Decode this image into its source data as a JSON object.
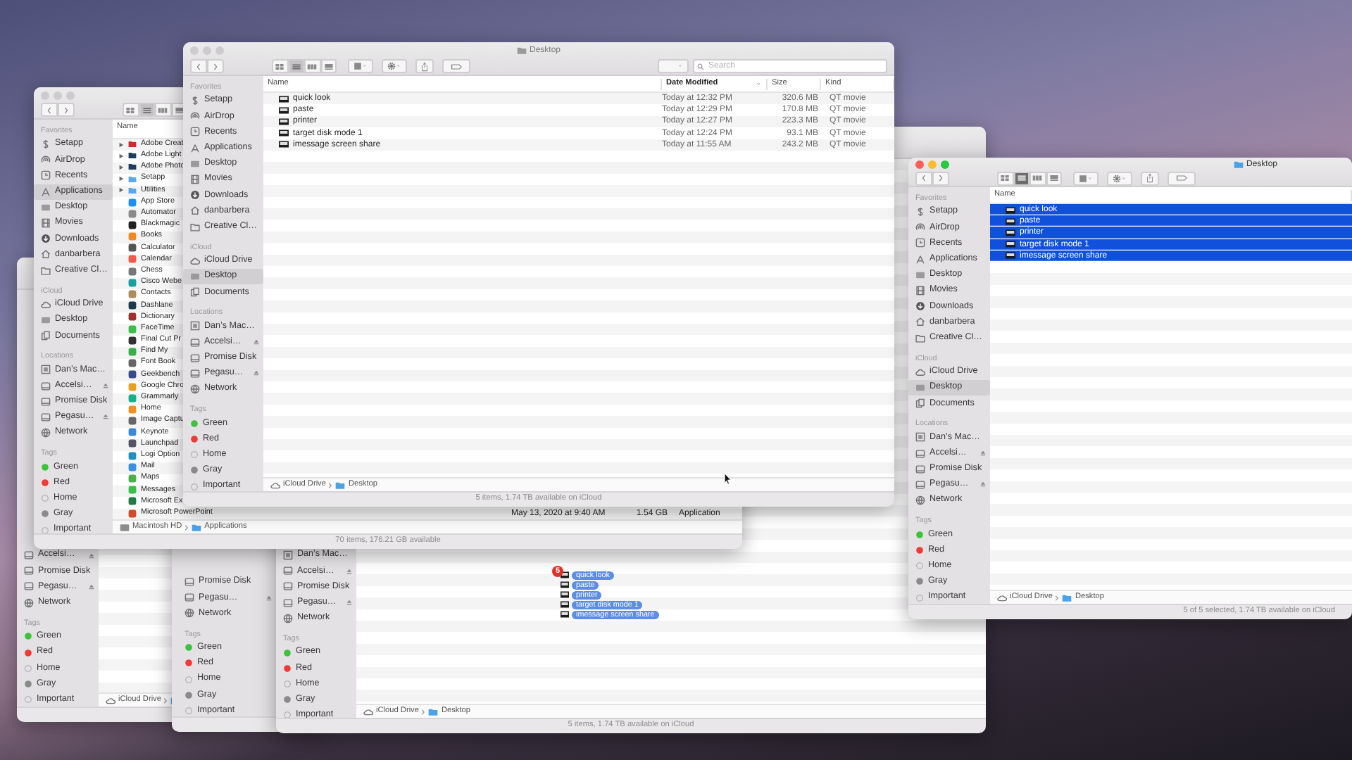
{
  "windows": [
    {
      "sidebar": [
        {
          "items": [
            {
              "label": "Accelsi…",
              "kind": "ext-disk",
              "selected": false
            },
            {
              "label": "Promise Disk",
              "kind": "disk",
              "selected": false
            },
            {
              "label": "Pegasu…",
              "kind": "ext-disk",
              "selected": false
            },
            {
              "label": "Network",
              "kind": "network",
              "selected": false
            }
          ]
        },
        {
          "heading": "Tags",
          "items": [
            {
              "label": "Green",
              "kind": "tag",
              "color": "#3cc23c",
              "selected": false
            },
            {
              "label": "Red",
              "kind": "tag",
              "color": "#f03a35",
              "selected": false
            },
            {
              "label": "Home",
              "kind": "tag",
              "selected": false
            },
            {
              "label": "Gray",
              "kind": "tag",
              "color": "#8a8a8a",
              "selected": false
            },
            {
              "label": "Important",
              "kind": "tag",
              "selected": false
            }
          ]
        }
      ],
      "path": [
        {
          "kind": "cloud",
          "label": "iCloud Drive"
        },
        {
          "kind": "folder"
        }
      ]
    },
    {
      "sidebar": [
        {
          "items": [
            {
              "label": "Promise Disk",
              "kind": "disk",
              "selected": false
            },
            {
              "label": "Pegasu…",
              "kind": "ext-disk",
              "selected": false
            },
            {
              "label": "Network",
              "kind": "network",
              "selected": false
            }
          ]
        },
        {
          "heading": "Tags",
          "items": [
            {
              "label": "Green",
              "kind": "tag",
              "color": "#3cc23c",
              "selected": false
            },
            {
              "label": "Red",
              "kind": "tag",
              "color": "#f03a35",
              "selected": false
            },
            {
              "label": "Home",
              "kind": "tag",
              "selected": false
            },
            {
              "label": "Gray",
              "kind": "tag",
              "color": "#8a8a8a",
              "selected": false
            },
            {
              "label": "Important",
              "kind": "tag",
              "selected": false
            }
          ]
        }
      ]
    },
    {
      "sidebar": [
        {
          "items": [
            {
              "label": "Dan’s Mac…",
              "kind": "computer",
              "selected": false
            },
            {
              "label": "Accelsi…",
              "kind": "ext-disk",
              "selected": false
            },
            {
              "label": "Promise Disk",
              "kind": "disk",
              "selected": false
            },
            {
              "label": "Pegasu…",
              "kind": "ext-disk",
              "selected": false
            },
            {
              "label": "Network",
              "kind": "network",
              "selected": false
            }
          ]
        },
        {
          "heading": "Tags",
          "items": [
            {
              "label": "Green",
              "kind": "tag",
              "color": "#3cc23c",
              "selected": false
            },
            {
              "label": "Red",
              "kind": "tag",
              "color": "#f03a35",
              "selected": false
            },
            {
              "label": "Home",
              "kind": "tag",
              "selected": false
            },
            {
              "label": "Gray",
              "kind": "tag",
              "color": "#8a8a8a",
              "selected": false
            },
            {
              "label": "Important",
              "kind": "tag",
              "selected": false
            }
          ]
        }
      ],
      "path": [
        {
          "kind": "cloud",
          "label": "iCloud Drive"
        },
        {
          "kind": "folder",
          "label": "Desktop"
        }
      ],
      "status": "5 items, 1.74 TB available on iCloud"
    },
    {
      "active": false,
      "toolbar": {
        "views": [
          {
            "selected": false
          },
          {
            "selected": true
          },
          {
            "selected": false
          },
          {
            "selected": false
          }
        ]
      },
      "sidebar": [
        {
          "heading": "Favorites",
          "items": [
            {
              "label": "Setapp",
              "kind": "app",
              "selected": false
            },
            {
              "label": "AirDrop",
              "kind": "airdrop",
              "selected": false
            },
            {
              "label": "Recents",
              "kind": "recents",
              "selected": false
            },
            {
              "label": "Applications",
              "kind": "applications",
              "selected": true
            },
            {
              "label": "Desktop",
              "kind": "desktop",
              "selected": false
            },
            {
              "label": "Movies",
              "kind": "film",
              "selected": false
            },
            {
              "label": "Downloads",
              "kind": "download",
              "selected": false
            },
            {
              "label": "danbarbera",
              "kind": "home",
              "selected": false
            },
            {
              "label": "Creative Cl…",
              "kind": "folder",
              "selected": false
            }
          ]
        },
        {
          "heading": "iCloud",
          "items": [
            {
              "label": "iCloud Drive",
              "kind": "cloud",
              "selected": false
            },
            {
              "label": "Desktop",
              "kind": "desktop",
              "selected": false
            },
            {
              "label": "Documents",
              "kind": "documents",
              "selected": false
            }
          ]
        },
        {
          "heading": "Locations",
          "items": [
            {
              "label": "Dan’s Mac…",
              "kind": "computer",
              "selected": false
            },
            {
              "label": "Accelsi…",
              "kind": "ext-disk",
              "selected": false
            },
            {
              "label": "Promise Disk",
              "kind": "disk",
              "selected": false
            },
            {
              "label": "Pegasu…",
              "kind": "ext-disk",
              "selected": false
            },
            {
              "label": "Network",
              "kind": "network",
              "selected": false
            }
          ]
        },
        {
          "heading": "Tags",
          "items": [
            {
              "label": "Green",
              "kind": "tag",
              "color": "#3cc23c",
              "selected": false
            },
            {
              "label": "Red",
              "kind": "tag",
              "color": "#f03a35",
              "selected": false
            },
            {
              "label": "Home",
              "kind": "tag",
              "selected": false
            },
            {
              "label": "Gray",
              "kind": "tag",
              "color": "#8a8a8a",
              "selected": false
            },
            {
              "label": "Important",
              "kind": "tag",
              "selected": false
            }
          ]
        }
      ],
      "columns": [
        {
          "label": "Name",
          "sorted": false
        }
      ],
      "rows": [
        {
          "name": "Adobe Creat",
          "kind": "folder",
          "color": "#d8262e",
          "selected": false
        },
        {
          "name": "Adobe Light",
          "kind": "folder",
          "color": "#1d3d5c",
          "selected": false
        },
        {
          "name": "Adobe Photo",
          "kind": "folder",
          "color": "#1f3b60",
          "selected": false
        },
        {
          "name": "Setapp",
          "kind": "folder",
          "color": "#5aa9e6",
          "selected": false
        },
        {
          "name": "Utilities",
          "kind": "folder",
          "color": "#5aa9e6",
          "selected": false
        },
        {
          "name": "App Store",
          "kind": "app",
          "color": "#1e8ef0",
          "selected": false
        },
        {
          "name": "Automator",
          "kind": "app",
          "color": "#8a8a8a",
          "selected": false
        },
        {
          "name": "Blackmagic",
          "kind": "app",
          "color": "#222222",
          "selected": false
        },
        {
          "name": "Books",
          "kind": "app",
          "color": "#f08a24",
          "selected": false
        },
        {
          "name": "Calculator",
          "kind": "app",
          "color": "#555555",
          "selected": false
        },
        {
          "name": "Calendar",
          "kind": "app",
          "color": "#f25a4a",
          "selected": false
        },
        {
          "name": "Chess",
          "kind": "app",
          "color": "#777777",
          "selected": false
        },
        {
          "name": "Cisco Webe",
          "kind": "app",
          "color": "#1aa0a0",
          "selected": false
        },
        {
          "name": "Contacts",
          "kind": "app",
          "color": "#b08a5a",
          "selected": false
        },
        {
          "name": "Dashlane",
          "kind": "app",
          "color": "#1c3a4a",
          "selected": false
        },
        {
          "name": "Dictionary",
          "kind": "app",
          "color": "#a03030",
          "selected": false
        },
        {
          "name": "FaceTime",
          "kind": "app",
          "color": "#3ac04a",
          "selected": false
        },
        {
          "name": "Final Cut Pr",
          "kind": "app",
          "color": "#333333",
          "selected": false
        },
        {
          "name": "Find My",
          "kind": "app",
          "color": "#3ab04a",
          "selected": false
        },
        {
          "name": "Font Book",
          "kind": "app",
          "color": "#666666",
          "selected": false
        },
        {
          "name": "Geekbench",
          "kind": "app",
          "color": "#3a4a8a",
          "selected": false
        },
        {
          "name": "Google Chro",
          "kind": "app",
          "color": "#e8a020",
          "selected": false
        },
        {
          "name": "Grammarly",
          "kind": "app",
          "color": "#16b08a",
          "selected": false
        },
        {
          "name": "Home",
          "kind": "app",
          "color": "#f09020",
          "selected": false
        },
        {
          "name": "Image Captu",
          "kind": "app",
          "color": "#666666",
          "selected": false
        },
        {
          "name": "Keynote",
          "kind": "app",
          "color": "#3a8ae0",
          "selected": false
        },
        {
          "name": "Launchpad",
          "kind": "app",
          "color": "#555566",
          "selected": false
        },
        {
          "name": "Logi Option",
          "kind": "app",
          "color": "#2090c0",
          "selected": false
        },
        {
          "name": "Mail",
          "kind": "app",
          "color": "#3a90e0",
          "selected": false
        },
        {
          "name": "Maps",
          "kind": "app",
          "color": "#4ab04a",
          "selected": false
        },
        {
          "name": "Messages",
          "kind": "app",
          "color": "#3ac04a",
          "selected": false
        },
        {
          "name": "Microsoft Ex",
          "kind": "app",
          "color": "#1f7a45",
          "selected": false
        },
        {
          "name": "Microsoft PowerPoint",
          "kind": "app",
          "color": "#d04a2a",
          "selected": false,
          "date_modified": "May 13, 2020 at 9:40 AM",
          "size": "1.54 GB",
          "item_kind": "Application"
        }
      ],
      "path": [
        {
          "kind": "disk",
          "label": "Macintosh HD"
        },
        {
          "kind": "folder",
          "label": "Applications"
        }
      ],
      "status": "70 items, 176.21 GB available"
    },
    {
      "active": false,
      "title": "Desktop",
      "toolbar": {
        "views": [
          {
            "selected": false
          },
          {
            "selected": true
          },
          {
            "selected": false
          },
          {
            "selected": false
          }
        ],
        "buttons": [
          {
            "kind": "group"
          },
          {
            "kind": "action"
          },
          {
            "kind": "share"
          },
          {
            "kind": "tag"
          },
          {
            "kind": "dropdown"
          }
        ],
        "search": {
          "placeholder": "Search"
        }
      },
      "sidebar": [
        {
          "heading": "Favorites",
          "items": [
            {
              "label": "Setapp",
              "kind": "app",
              "selected": false
            },
            {
              "label": "AirDrop",
              "kind": "airdrop",
              "selected": false
            },
            {
              "label": "Recents",
              "kind": "recents",
              "selected": false
            },
            {
              "label": "Applications",
              "kind": "applications",
              "selected": false
            },
            {
              "label": "Desktop",
              "kind": "desktop",
              "selected": false
            },
            {
              "label": "Movies",
              "kind": "film",
              "selected": false
            },
            {
              "label": "Downloads",
              "kind": "download",
              "selected": false
            },
            {
              "label": "danbarbera",
              "kind": "home",
              "selected": false
            },
            {
              "label": "Creative Cl…",
              "kind": "folder",
              "selected": false
            }
          ]
        },
        {
          "heading": "iCloud",
          "items": [
            {
              "label": "iCloud Drive",
              "kind": "cloud",
              "selected": false
            },
            {
              "label": "Desktop",
              "kind": "desktop",
              "selected": true
            },
            {
              "label": "Documents",
              "kind": "documents",
              "selected": false
            }
          ]
        },
        {
          "heading": "Locations",
          "items": [
            {
              "label": "Dan’s Mac…",
              "kind": "computer",
              "selected": false
            },
            {
              "label": "Accelsi…",
              "kind": "ext-disk",
              "selected": false
            },
            {
              "label": "Promise Disk",
              "kind": "disk",
              "selected": false
            },
            {
              "label": "Pegasu…",
              "kind": "ext-disk",
              "selected": false
            },
            {
              "label": "Network",
              "kind": "network",
              "selected": false
            }
          ]
        },
        {
          "heading": "Tags",
          "items": [
            {
              "label": "Green",
              "kind": "tag",
              "color": "#3cc23c",
              "selected": false
            },
            {
              "label": "Red",
              "kind": "tag",
              "color": "#f03a35",
              "selected": false
            },
            {
              "label": "Home",
              "kind": "tag",
              "selected": false
            },
            {
              "label": "Gray",
              "kind": "tag",
              "color": "#8a8a8a",
              "selected": false
            },
            {
              "label": "Important",
              "kind": "tag",
              "selected": false
            }
          ]
        }
      ],
      "columns": [
        {
          "label": "Name",
          "sorted": false
        },
        {
          "label": "Date Modified",
          "sorted": true
        },
        {
          "label": "Size",
          "sorted": false
        },
        {
          "label": "Kind",
          "sorted": false
        }
      ],
      "rows": [
        {
          "name": "quick look",
          "kind": "movie",
          "date_modified": "Today at 12:32 PM",
          "size": "320.6 MB",
          "item_kind": "QT movie",
          "selected": false
        },
        {
          "name": "paste",
          "kind": "movie",
          "date_modified": "Today at 12:29 PM",
          "size": "170.8 MB",
          "item_kind": "QT movie",
          "selected": false
        },
        {
          "name": "printer",
          "kind": "movie",
          "date_modified": "Today at 12:27 PM",
          "size": "223.3 MB",
          "item_kind": "QT movie",
          "selected": false
        },
        {
          "name": "target disk mode 1",
          "kind": "movie",
          "date_modified": "Today at 12:24 PM",
          "size": "93.1 MB",
          "item_kind": "QT movie",
          "selected": false
        },
        {
          "name": "imessage screen share",
          "kind": "movie",
          "date_modified": "Today at 11:55 AM",
          "size": "243.2 MB",
          "item_kind": "QT movie",
          "selected": false
        }
      ],
      "path": [
        {
          "kind": "cloud",
          "label": "iCloud Drive"
        },
        {
          "kind": "folder",
          "label": "Desktop"
        }
      ],
      "status": "5 items, 1.74 TB available on iCloud"
    },
    {
      "active": true,
      "title": "Desktop",
      "toolbar": {
        "views": [
          {
            "selected": false
          },
          {
            "selected": true
          },
          {
            "selected": false
          },
          {
            "selected": false
          }
        ],
        "buttons": [
          {
            "kind": "group"
          },
          {
            "kind": "action"
          },
          {
            "kind": "share"
          },
          {
            "kind": "tag"
          }
        ]
      },
      "sidebar": [
        {
          "heading": "Favorites",
          "items": [
            {
              "label": "Setapp",
              "kind": "app",
              "selected": false
            },
            {
              "label": "AirDrop",
              "kind": "airdrop",
              "selected": false
            },
            {
              "label": "Recents",
              "kind": "recents",
              "selected": false
            },
            {
              "label": "Applications",
              "kind": "applications",
              "selected": false
            },
            {
              "label": "Desktop",
              "kind": "desktop",
              "selected": false
            },
            {
              "label": "Movies",
              "kind": "film",
              "selected": false
            },
            {
              "label": "Downloads",
              "kind": "download",
              "selected": false
            },
            {
              "label": "danbarbera",
              "kind": "home",
              "selected": false
            },
            {
              "label": "Creative Cl…",
              "kind": "folder",
              "selected": false
            }
          ]
        },
        {
          "heading": "iCloud",
          "items": [
            {
              "label": "iCloud Drive",
              "kind": "cloud",
              "selected": false
            },
            {
              "label": "Desktop",
              "kind": "desktop",
              "selected": true
            },
            {
              "label": "Documents",
              "kind": "documents",
              "selected": false
            }
          ]
        },
        {
          "heading": "Locations",
          "items": [
            {
              "label": "Dan’s Mac…",
              "kind": "computer",
              "selected": false
            },
            {
              "label": "Accelsi…",
              "kind": "ext-disk",
              "selected": false
            },
            {
              "label": "Promise Disk",
              "kind": "disk",
              "selected": false
            },
            {
              "label": "Pegasu…",
              "kind": "ext-disk",
              "selected": false
            },
            {
              "label": "Network",
              "kind": "network",
              "selected": false
            }
          ]
        },
        {
          "heading": "Tags",
          "items": [
            {
              "label": "Green",
              "kind": "tag",
              "color": "#3cc23c",
              "selected": false
            },
            {
              "label": "Red",
              "kind": "tag",
              "color": "#f03a35",
              "selected": false
            },
            {
              "label": "Home",
              "kind": "tag",
              "selected": false
            },
            {
              "label": "Gray",
              "kind": "tag",
              "color": "#8a8a8a",
              "selected": false
            },
            {
              "label": "Important",
              "kind": "tag",
              "selected": false
            }
          ]
        }
      ],
      "columns": [
        {
          "label": "Name",
          "sorted": false
        }
      ],
      "rows": [
        {
          "name": "quick look",
          "kind": "movie",
          "selected": true
        },
        {
          "name": "paste",
          "kind": "movie",
          "selected": true
        },
        {
          "name": "printer",
          "kind": "movie",
          "selected": true
        },
        {
          "name": "target disk mode 1",
          "kind": "movie",
          "selected": true
        },
        {
          "name": "imessage screen share",
          "kind": "movie",
          "selected": true
        }
      ],
      "path": [
        {
          "kind": "cloud",
          "label": "iCloud Drive"
        },
        {
          "kind": "folder",
          "label": "Desktop"
        }
      ],
      "status": "5 of 5 selected, 1.74 TB available on iCloud"
    }
  ],
  "drag_preview": {
    "badge": "5",
    "items": [
      {
        "name": "quick look"
      },
      {
        "name": "paste"
      },
      {
        "name": "printer"
      },
      {
        "name": "target disk mode 1"
      },
      {
        "name": "imessage screen share"
      }
    ]
  }
}
